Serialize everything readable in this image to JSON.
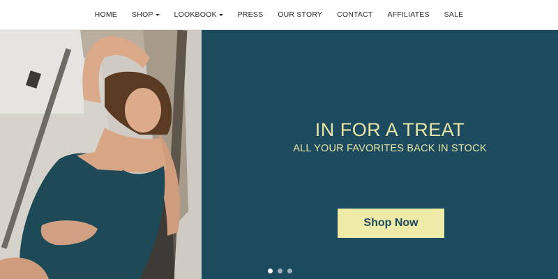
{
  "nav": {
    "items": [
      {
        "label": "HOME",
        "dropdown": false
      },
      {
        "label": "SHOP",
        "dropdown": true
      },
      {
        "label": "LOOKBOOK",
        "dropdown": true
      },
      {
        "label": "PRESS",
        "dropdown": false
      },
      {
        "label": "OUR STORY",
        "dropdown": false
      },
      {
        "label": "CONTACT",
        "dropdown": false
      },
      {
        "label": "AFFILIATES",
        "dropdown": false
      },
      {
        "label": "SALE",
        "dropdown": false
      }
    ]
  },
  "hero": {
    "headline": "IN FOR A TREAT",
    "subheadline": "ALL YOUR FAVORITES BACK IN STOCK",
    "cta_label": "Shop Now",
    "slides_count": 3,
    "active_slide": 1,
    "colors": {
      "panel_bg": "#1c4a5e",
      "headline_text": "#e8e4a4",
      "button_bg": "#eeeaa8",
      "button_text": "#1f4a5e"
    }
  }
}
